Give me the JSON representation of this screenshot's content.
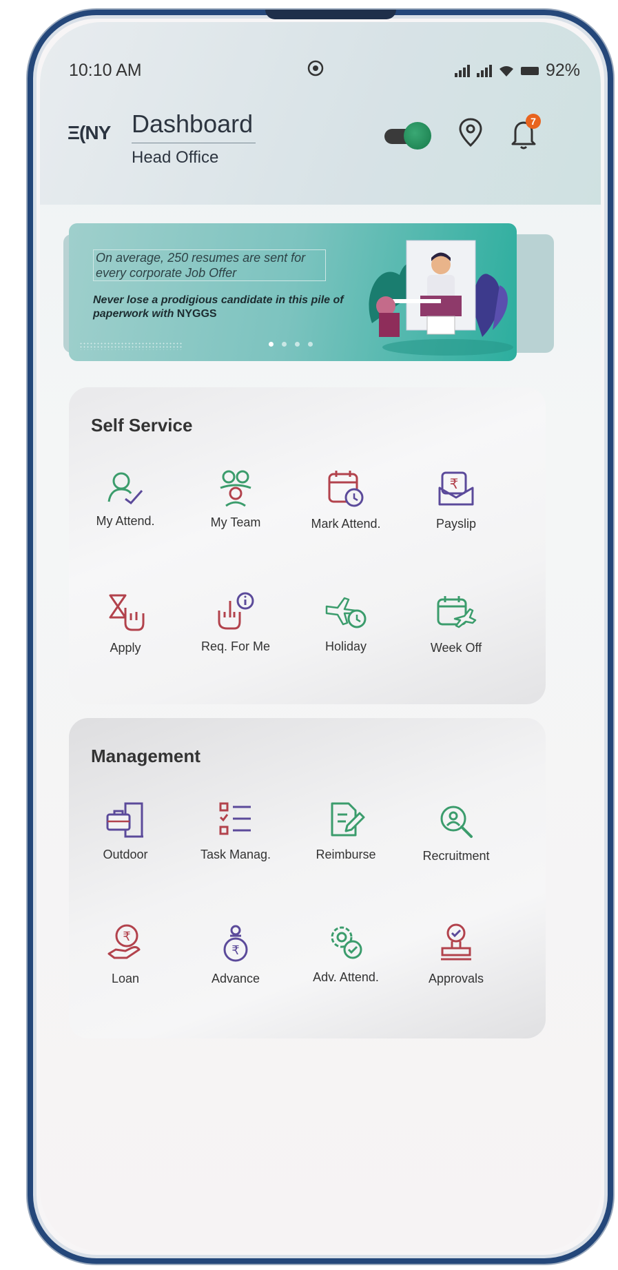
{
  "status_bar": {
    "time": "10:10 AM",
    "battery": "92%"
  },
  "header": {
    "logo": "Ξ(NY",
    "title": "Dashboard",
    "subtitle": "Head Office",
    "notification_count": "7"
  },
  "banner": {
    "line1": "On average, 250 resumes are sent for every corporate Job Offer",
    "line2_prefix": "Never lose a prodigious candidate in this pile of paperwork with ",
    "line2_brand": "NYGGS",
    "active_slide": 1,
    "slide_count": 4
  },
  "self_service": {
    "title": "Self Service",
    "items": [
      {
        "label": "My Attend.",
        "icon": "user-check-icon"
      },
      {
        "label": "My Team",
        "icon": "team-icon"
      },
      {
        "label": "Mark Attend.",
        "icon": "calendar-clock-icon"
      },
      {
        "label": "Payslip",
        "icon": "rupee-envelope-icon"
      },
      {
        "label": "Apply",
        "icon": "hourglass-hand-icon"
      },
      {
        "label": "Req. For Me",
        "icon": "hand-info-icon"
      },
      {
        "label": "Holiday",
        "icon": "plane-clock-icon"
      },
      {
        "label": "Week Off",
        "icon": "calendar-plane-icon"
      }
    ]
  },
  "management": {
    "title": "Management",
    "items": [
      {
        "label": "Outdoor",
        "icon": "door-briefcase-icon"
      },
      {
        "label": "Task Manag.",
        "icon": "task-list-icon"
      },
      {
        "label": "Reimburse",
        "icon": "document-edit-icon"
      },
      {
        "label": "Recruitment",
        "icon": "search-person-icon"
      },
      {
        "label": "Loan",
        "icon": "rupee-hand-icon"
      },
      {
        "label": "Advance",
        "icon": "rupee-bag-icon"
      },
      {
        "label": "Adv. Attend.",
        "icon": "gear-check-icon"
      },
      {
        "label": "Approvals",
        "icon": "stamp-icon"
      }
    ]
  },
  "colors": {
    "frame": "#24477a",
    "accent_green": "#2a9d73",
    "icon_purple": "#5b4a9a",
    "icon_red": "#b2424c",
    "icon_green": "#3b9c6c",
    "badge_orange": "#e8641f"
  }
}
